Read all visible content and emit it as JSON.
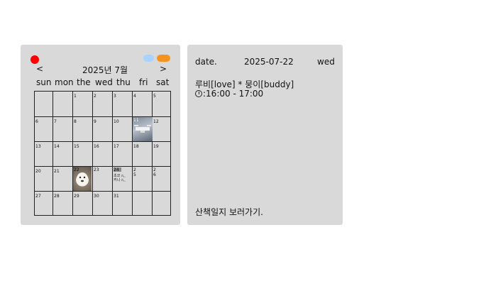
{
  "calendar": {
    "nav_prev": "<",
    "nav_next": ">",
    "month_title": "2025년 7월",
    "weekdays": [
      "sun",
      "mon",
      "the",
      "wed",
      "thu",
      "fri",
      "sat"
    ],
    "days": [
      "1",
      "2",
      "3",
      "4",
      "5",
      "6",
      "7",
      "8",
      "9",
      "10",
      "11",
      "12",
      "13",
      "14",
      "15",
      "16",
      "17",
      "18",
      "19",
      "20",
      "21",
      "22",
      "23",
      "24",
      "25",
      "26",
      "27",
      "28",
      "29",
      "30",
      "31"
    ],
    "day25_split": [
      "2",
      "5"
    ],
    "day26_split": [
      "2",
      "6"
    ],
    "memo_24_line1": "초코 ෆ⸒⸒",
    "memo_24_line2": "커니 ෆ⸒⸒",
    "colors": {
      "close": "#ff0000",
      "blue_dot": "#a9d3ff",
      "orange_dot": "#f6931e",
      "panel": "#d9d9d9"
    }
  },
  "detail": {
    "date_label": "date.",
    "date_value": "2025-07-22",
    "weekday": "wed",
    "walkers": "루비[love] * 뭉이[buddy]",
    "time_range": ":16:00 - 17:00",
    "log_link": "산책일지 보러가기."
  }
}
